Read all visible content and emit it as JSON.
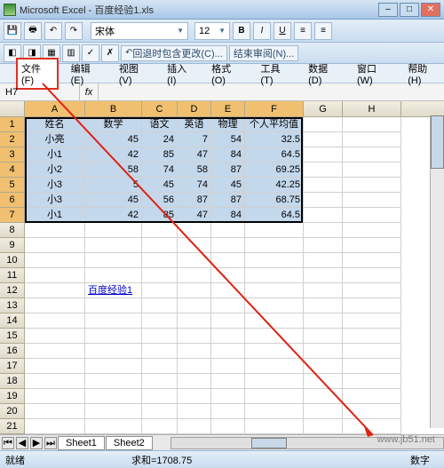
{
  "title": "Microsoft Excel - 百度经验1.xls",
  "font": {
    "name": "宋体",
    "size": "12"
  },
  "format_btns": {
    "bold": "B",
    "italic": "I",
    "underline": "U"
  },
  "toolbar2_cmds": [
    "回退时包含更改(C)...",
    "结束审阅(N)..."
  ],
  "menubar": [
    "文件(F)",
    "编辑(E)",
    "视图(V)",
    "插入(I)",
    "格式(O)",
    "工具(T)",
    "数据(D)",
    "窗口(W)",
    "帮助(H)"
  ],
  "namebox": "H7",
  "fx_label": "fx",
  "columns": [
    "A",
    "B",
    "C",
    "D",
    "E",
    "F",
    "G",
    "H"
  ],
  "headers": [
    "姓名",
    "数学",
    "语文",
    "英语",
    "物理",
    "个人平均值"
  ],
  "rows": [
    {
      "name": "小亮",
      "v": [
        45,
        24,
        7,
        54,
        32.5
      ]
    },
    {
      "name": "小1",
      "v": [
        42,
        85,
        47,
        84,
        64.5
      ]
    },
    {
      "name": "小2",
      "v": [
        58,
        74,
        58,
        87,
        69.25
      ]
    },
    {
      "name": "小3",
      "v": [
        5,
        45,
        74,
        45,
        42.25
      ]
    },
    {
      "name": "小3",
      "v": [
        45,
        56,
        87,
        87,
        68.75
      ]
    },
    {
      "name": "小1",
      "v": [
        42,
        85,
        47,
        84,
        64.5
      ]
    }
  ],
  "link_text": "百度经验1",
  "tabs": [
    "Sheet1",
    "Sheet2"
  ],
  "status": {
    "ready": "就绪",
    "sum": "求和=1708.75",
    "mode": "数字"
  },
  "watermark": "www.jb51.net",
  "chart_data": {
    "type": "table",
    "title": "",
    "columns": [
      "姓名",
      "数学",
      "语文",
      "英语",
      "物理",
      "个人平均值"
    ],
    "data": [
      [
        "小亮",
        45,
        24,
        7,
        54,
        32.5
      ],
      [
        "小1",
        42,
        85,
        47,
        84,
        64.5
      ],
      [
        "小2",
        58,
        74,
        58,
        87,
        69.25
      ],
      [
        "小3",
        5,
        45,
        74,
        45,
        42.25
      ],
      [
        "小3",
        45,
        56,
        87,
        87,
        68.75
      ],
      [
        "小1",
        42,
        85,
        47,
        84,
        64.5
      ]
    ]
  }
}
